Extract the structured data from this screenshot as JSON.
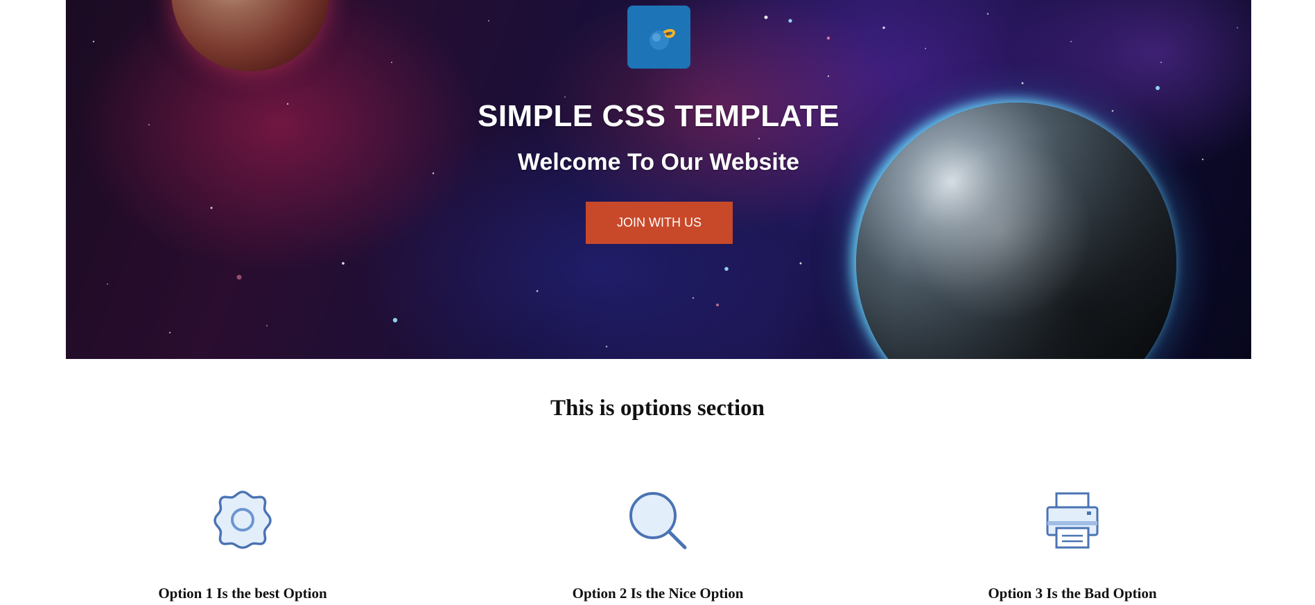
{
  "hero": {
    "title": "SIMPLE CSS TEMPLATE",
    "subtitle": "Welcome To Our Website",
    "cta_label": "JOIN WITH US",
    "logo_icon": "planet-logo-icon"
  },
  "options": {
    "heading": "This is options section",
    "items": [
      {
        "label": "Option 1 Is the best Option",
        "icon": "gear-icon"
      },
      {
        "label": "Option 2 Is the Nice Option",
        "icon": "search-icon"
      },
      {
        "label": "Option 3 Is the Bad Option",
        "icon": "printer-icon"
      }
    ]
  },
  "colors": {
    "cta_background": "#c8492a",
    "logo_background": "#1d74b6",
    "icon_stroke": "#4a73b3",
    "icon_fill": "#e3eefb"
  }
}
